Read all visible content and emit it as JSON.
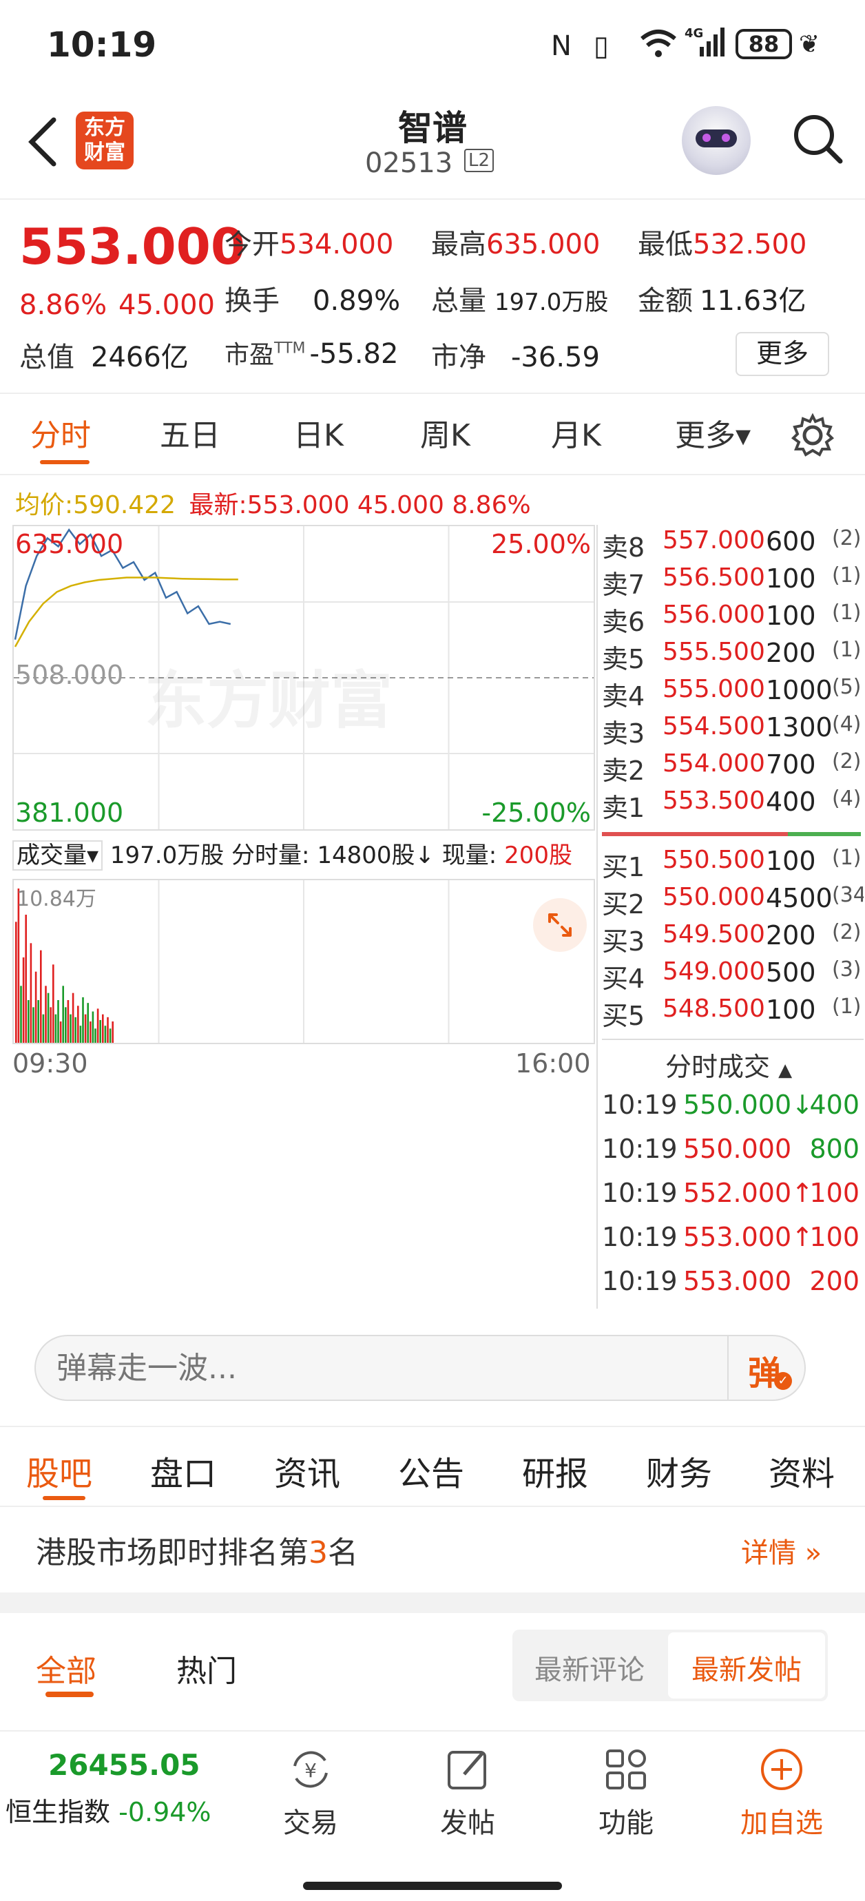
{
  "status_bar": {
    "time": "10:19",
    "battery": "88",
    "network": "4G"
  },
  "header": {
    "logo_text_top": "东方",
    "logo_text_bottom": "财富",
    "stock_name": "智谱",
    "stock_code": "02513",
    "level_badge": "L2"
  },
  "quote": {
    "price": "553.000",
    "change_pct": "8.86%",
    "change_amt": "45.000",
    "open_label": "今开",
    "open": "534.000",
    "high_label": "最高",
    "high": "635.000",
    "low_label": "最低",
    "low": "532.500",
    "turnover_label": "换手",
    "turnover": "0.89%",
    "volume_label": "总量",
    "volume": "197.0万股",
    "amount_label": "金额",
    "amount": "11.63亿",
    "mcap_label": "总值",
    "mcap": "2466亿",
    "pe_label": "市盈",
    "pe_sup": "TTM",
    "pe": "-55.82",
    "pb_label": "市净",
    "pb": "-36.59",
    "more_button": "更多"
  },
  "chart_tabs": [
    {
      "label": "分时",
      "active": true
    },
    {
      "label": "五日",
      "active": false
    },
    {
      "label": "日K",
      "active": false
    },
    {
      "label": "周K",
      "active": false
    },
    {
      "label": "月K",
      "active": false
    },
    {
      "label": "更多▾",
      "active": false
    }
  ],
  "legend": {
    "avg_label": "均价:",
    "avg_value": "590.422",
    "latest_label": "最新:",
    "latest_value": "553.000 45.000 8.86%"
  },
  "price_axis": {
    "top": "635.000",
    "mid": "508.000",
    "bottom": "381.000",
    "top_pct": "25.00%",
    "bottom_pct": "-25.00%"
  },
  "watermark": "东方财富",
  "chart_data": {
    "type": "line",
    "ylim": [
      381.0,
      635.0
    ],
    "series": [
      {
        "name": "最新",
        "values": [
          540,
          585,
          610,
          625,
          618,
          632,
          620,
          628,
          610,
          615,
          600,
          605,
          590,
          596,
          575,
          580,
          562,
          568,
          553,
          555,
          553
        ]
      },
      {
        "name": "均价",
        "values": [
          534,
          555,
          570,
          580,
          585,
          588,
          590,
          591,
          592,
          592,
          592,
          591.5,
          591,
          590.8,
          590.6,
          590.4,
          590.4
        ]
      }
    ],
    "volume_bars_note": "",
    "volume_max_label": "10.84万",
    "volume_values_wan": [
      8.5,
      10.84,
      4,
      6,
      9,
      3,
      7,
      2.5,
      5,
      3,
      6.5,
      2,
      4,
      3.5,
      2.5,
      5.5,
      2,
      3,
      1.5,
      4,
      2.5,
      3,
      2,
      3.5,
      1.8,
      2.6,
      1.2,
      3.2,
      2,
      2.8,
      1.5,
      2.2,
      1,
      2.4,
      1.6,
      2,
      1.2,
      1.8,
      1,
      1.5
    ],
    "volume_colors": [
      "r",
      "r",
      "g",
      "r",
      "r",
      "g",
      "r",
      "g",
      "r",
      "g",
      "r",
      "g",
      "r",
      "g",
      "r",
      "r",
      "g",
      "g",
      "r",
      "g",
      "g",
      "r",
      "g",
      "r",
      "g",
      "r",
      "g",
      "g",
      "r",
      "g",
      "r",
      "g",
      "g",
      "r",
      "g",
      "r",
      "g",
      "r",
      "g",
      "r"
    ],
    "time_start": "09:30",
    "time_end": "16:00"
  },
  "volume_legend": {
    "label": "成交量▾",
    "total": "197.0万股",
    "minute_label": "分时量:",
    "minute": "14800股↓",
    "now_label": "现量:",
    "now": "200股"
  },
  "order_book": {
    "asks": [
      {
        "label": "卖8",
        "price": "557.000",
        "qty": "600",
        "orders": "(2)"
      },
      {
        "label": "卖7",
        "price": "556.500",
        "qty": "100",
        "orders": "(1)"
      },
      {
        "label": "卖6",
        "price": "556.000",
        "qty": "100",
        "orders": "(1)"
      },
      {
        "label": "卖5",
        "price": "555.500",
        "qty": "200",
        "orders": "(1)"
      },
      {
        "label": "卖4",
        "price": "555.000",
        "qty": "1000",
        "orders": "(5)"
      },
      {
        "label": "卖3",
        "price": "554.500",
        "qty": "1300",
        "orders": "(4)"
      },
      {
        "label": "卖2",
        "price": "554.000",
        "qty": "700",
        "orders": "(2)"
      },
      {
        "label": "卖1",
        "price": "553.500",
        "qty": "400",
        "orders": "(4)"
      }
    ],
    "bids": [
      {
        "label": "买1",
        "price": "550.500",
        "qty": "100",
        "orders": "(1)"
      },
      {
        "label": "买2",
        "price": "550.000",
        "qty": "4500",
        "orders": "(34)"
      },
      {
        "label": "买3",
        "price": "549.500",
        "qty": "200",
        "orders": "(2)"
      },
      {
        "label": "买4",
        "price": "549.000",
        "qty": "500",
        "orders": "(3)"
      },
      {
        "label": "买5",
        "price": "548.500",
        "qty": "100",
        "orders": "(1)"
      }
    ]
  },
  "trades": {
    "title": "分时成交",
    "rows": [
      {
        "time": "10:19",
        "price": "550.000",
        "dir": "↓",
        "qty": "400",
        "color": "#1a9a2a"
      },
      {
        "time": "10:19",
        "price": "550.000",
        "dir": "",
        "qty": "800",
        "color": "#1a9a2a"
      },
      {
        "time": "10:19",
        "price": "552.000",
        "dir": "↑",
        "qty": "100",
        "color": "#e02020"
      },
      {
        "time": "10:19",
        "price": "553.000",
        "dir": "↑",
        "qty": "100",
        "color": "#e02020"
      },
      {
        "time": "10:19",
        "price": "553.000",
        "dir": "",
        "qty": "200",
        "color": "#e02020"
      }
    ]
  },
  "danmu": {
    "placeholder": "弹幕走一波...",
    "button": "弹"
  },
  "section_tabs": [
    "股吧",
    "盘口",
    "资讯",
    "公告",
    "研报",
    "财务",
    "资料"
  ],
  "rank": {
    "prefix": "港股市场即时排名第",
    "rank": "3",
    "suffix": "名",
    "detail": "详情"
  },
  "filters": {
    "all": "全部",
    "hot": "热门",
    "latest_comment": "最新评论",
    "latest_post": "最新发帖"
  },
  "bottom_bar": {
    "index_value": "26455.05",
    "index_name": "恒生指数",
    "index_change": "-0.94%",
    "items": [
      "交易",
      "发帖",
      "功能",
      "加自选"
    ]
  },
  "colors": {
    "accent": "#ea5a10",
    "up": "#e02020",
    "down": "#1a9a2a",
    "avg": "#d4b000",
    "price_line": "#3b6ea8"
  }
}
